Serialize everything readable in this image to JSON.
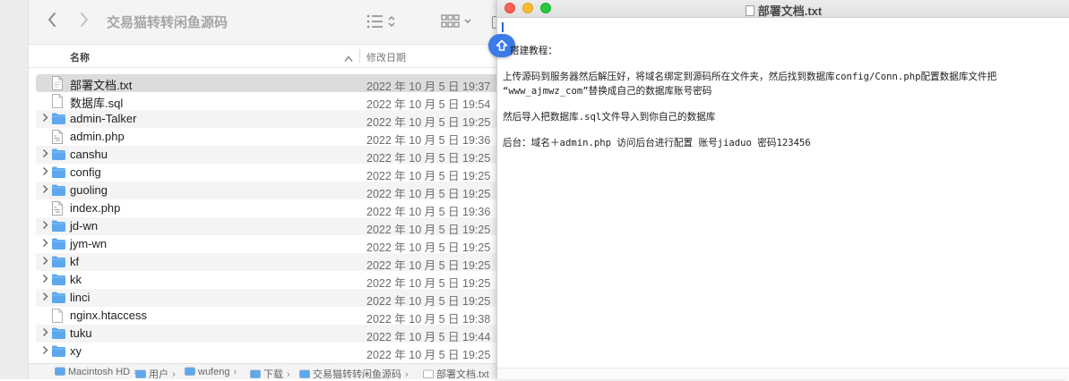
{
  "finder": {
    "title": "交易猫转转闲鱼源码",
    "back_icon": "chevron-left-icon",
    "forward_icon": "chevron-right-icon",
    "columns": {
      "name": "名称",
      "date": "修改日期"
    },
    "files": [
      {
        "name": "部署文档.txt",
        "date": "2022 年 10 月 5 日 19:37",
        "kind": "txt",
        "folder": false
      },
      {
        "name": "数据库.sql",
        "date": "2022 年 10 月 5 日 19:54",
        "kind": "doc",
        "folder": false
      },
      {
        "name": "admin-Talker",
        "date": "2022 年 10 月 5 日 19:25",
        "kind": "folder",
        "folder": true
      },
      {
        "name": "admin.php",
        "date": "2022 年 10 月 5 日 19:36",
        "kind": "php",
        "folder": false
      },
      {
        "name": "canshu",
        "date": "2022 年 10 月 5 日 19:25",
        "kind": "folder",
        "folder": true
      },
      {
        "name": "config",
        "date": "2022 年 10 月 5 日 19:25",
        "kind": "folder",
        "folder": true
      },
      {
        "name": "guoling",
        "date": "2022 年 10 月 5 日 19:25",
        "kind": "folder",
        "folder": true
      },
      {
        "name": "index.php",
        "date": "2022 年 10 月 5 日 19:36",
        "kind": "php",
        "folder": false
      },
      {
        "name": "jd-wn",
        "date": "2022 年 10 月 5 日 19:25",
        "kind": "folder",
        "folder": true
      },
      {
        "name": "jym-wn",
        "date": "2022 年 10 月 5 日 19:25",
        "kind": "folder",
        "folder": true
      },
      {
        "name": "kf",
        "date": "2022 年 10 月 5 日 19:25",
        "kind": "folder",
        "folder": true
      },
      {
        "name": "kk",
        "date": "2022 年 10 月 5 日 19:25",
        "kind": "folder",
        "folder": true
      },
      {
        "name": "linci",
        "date": "2022 年 10 月 5 日 19:25",
        "kind": "folder",
        "folder": true
      },
      {
        "name": "nginx.htaccess",
        "date": "2022 年 10 月 5 日 19:38",
        "kind": "doc",
        "folder": false
      },
      {
        "name": "tuku",
        "date": "2022 年 10 月 5 日 19:44",
        "kind": "folder",
        "folder": true
      },
      {
        "name": "xy",
        "date": "2022 年 10 月 5 日 19:25",
        "kind": "folder",
        "folder": true
      }
    ],
    "selected_index": 0,
    "path": [
      {
        "label": "Macintosh HD",
        "icon": "hard-drive-icon"
      },
      {
        "label": "用户",
        "icon": "folder-icon"
      },
      {
        "label": "wufeng",
        "icon": "home-folder-icon"
      },
      {
        "label": "下载",
        "icon": "folder-icon"
      },
      {
        "label": "交易猫转转闲鱼源码",
        "icon": "folder-icon"
      },
      {
        "label": "部署文档.txt",
        "icon": "document-icon"
      }
    ]
  },
  "editor": {
    "window_title": "部署文档.txt",
    "lines": [
      "搭建教程：",
      "上传源码到服务器然后解压好，将域名绑定到源码所在文件夹，然后找到数据库config/Conn.php配置数据库文件把",
      "“www_ajmwz_com”替换成自己的数据库账号密码",
      "然后导入把数据库.sql文件导入到你自己的数据库",
      "后台：域名＋admin.php 访问后台进行配置  账号jiaduo 密码123456"
    ]
  },
  "colors": {
    "folder_blue": "#5ba8ee",
    "selection_gray": "#dcdcdc",
    "accent_blue": "#3a7be8"
  }
}
